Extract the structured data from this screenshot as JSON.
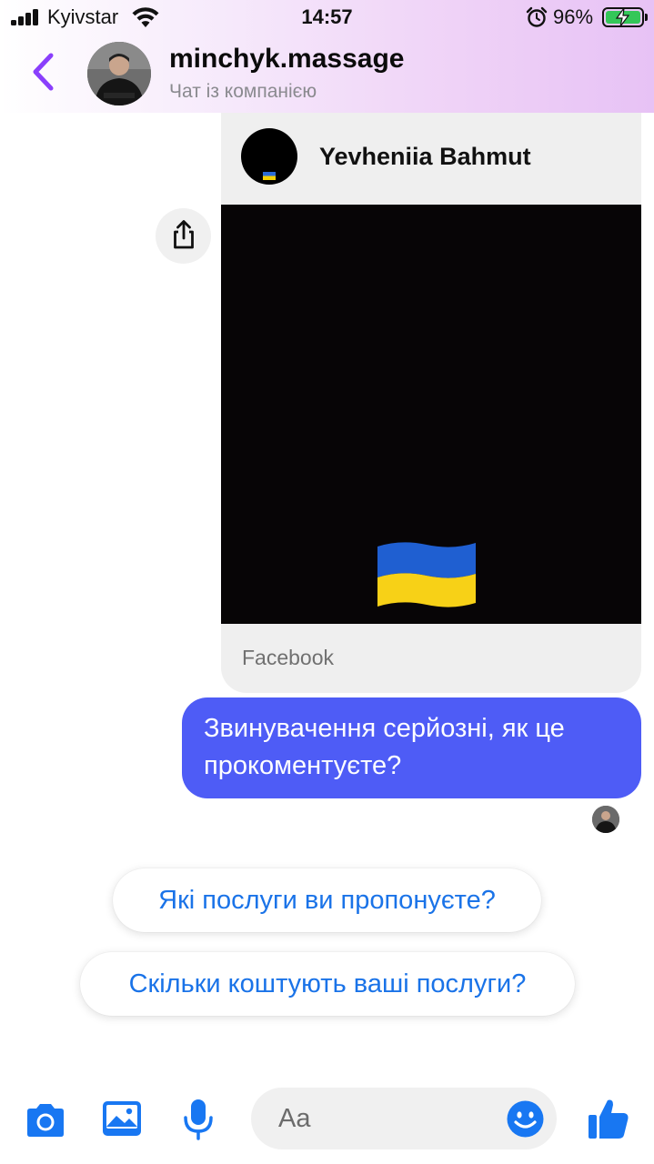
{
  "status_bar": {
    "carrier": "Kyivstar",
    "time": "14:57",
    "battery_percent": "96%",
    "icons": [
      "signal-icon",
      "wifi-icon",
      "alarm-icon",
      "battery-charging-icon"
    ]
  },
  "header": {
    "title": "minchyk.massage",
    "subtitle": "Чат із компанією",
    "icons": [
      "back-chevron-icon"
    ],
    "accent_color": "#8a3ffc"
  },
  "shared_post": {
    "author": "Yevheniia Bahmut",
    "source": "Facebook",
    "icons": [
      "share-icon",
      "ukraine-flag-icon"
    ]
  },
  "messages": [
    {
      "direction": "outgoing",
      "text": "Звинувачення серйозні, як це прокоментуєте?",
      "color": "#4e5cf6"
    }
  ],
  "quick_replies": [
    "Які послуги ви пропонуєте?",
    "Скільки коштують ваші послуги?"
  ],
  "composer": {
    "placeholder": "Aa",
    "icons": [
      "camera-icon",
      "gallery-icon",
      "microphone-icon",
      "emoji-icon",
      "thumbs-up-icon"
    ],
    "icon_color": "#1877f2"
  }
}
